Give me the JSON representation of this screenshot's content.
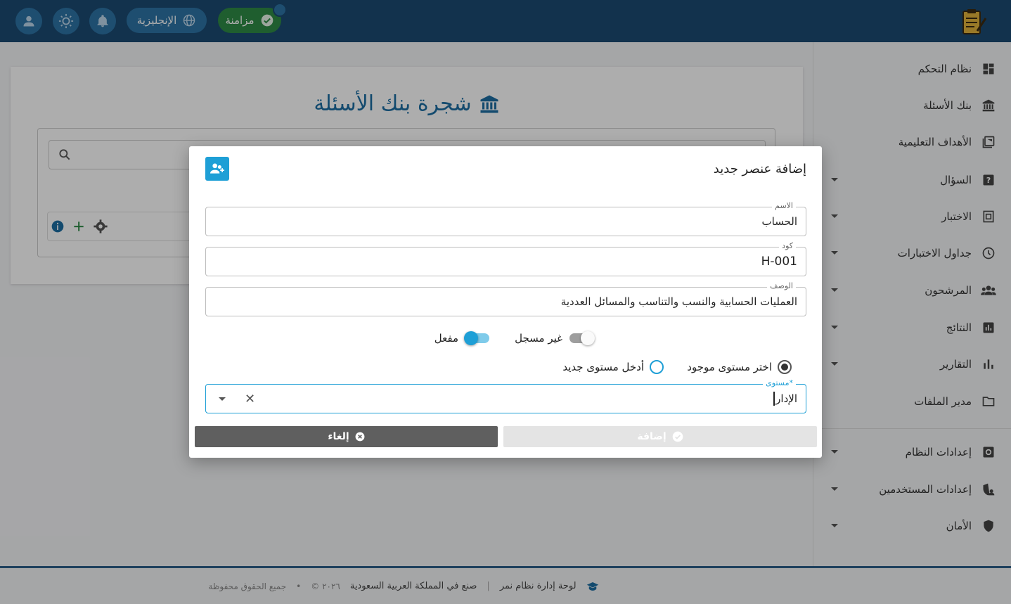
{
  "topbar": {
    "language_label": "الإنجليزية",
    "sync_label": "مزامنة"
  },
  "sidebar": {
    "items": [
      {
        "label": "نظام التحكم",
        "icon": "dashboard-icon",
        "expandable": false
      },
      {
        "label": "بنك الأسئلة",
        "icon": "bank-icon",
        "expandable": false
      },
      {
        "label": "الأهداف التعليمية",
        "icon": "objectives-icon",
        "expandable": false
      },
      {
        "label": "السؤال",
        "icon": "question-icon",
        "expandable": true
      },
      {
        "label": "الاختبار",
        "icon": "exam-icon",
        "expandable": true
      },
      {
        "label": "جداول الاختبارات",
        "icon": "clock-icon",
        "expandable": true
      },
      {
        "label": "المرشحون",
        "icon": "people-icon",
        "expandable": true
      },
      {
        "label": "النتائج",
        "icon": "results-icon",
        "expandable": true
      },
      {
        "label": "التقارير",
        "icon": "bar-chart-icon",
        "expandable": true
      },
      {
        "label": "مدير الملفات",
        "icon": "folder-icon",
        "expandable": false
      },
      {
        "label": "إعدادات النظام",
        "icon": "gear-icon",
        "expandable": true
      },
      {
        "label": "إعدادات المستخدمين",
        "icon": "user-shield-icon",
        "expandable": true
      },
      {
        "label": "الأمان",
        "icon": "shield-icon",
        "expandable": true
      }
    ]
  },
  "main": {
    "title": "شجرة بنك الأسئلة"
  },
  "dialog": {
    "title": "إضافة عنصر جديد",
    "name_label": "الاسم",
    "name_value": "الحساب",
    "code_label": "كود",
    "code_value": "H-001",
    "desc_label": "الوصف",
    "desc_value": "العمليات الحسابية والنسب والتناسب والمسائل العددية",
    "toggle_unregistered": "غير مسجل",
    "toggle_enabled": "مفعل",
    "radio_existing": "اختر مستوى موجود",
    "radio_new": "أدخل مستوى جديد",
    "level_label": "مستوى",
    "level_value": "الإدار",
    "add_button": "إضافة",
    "cancel_button": "إلغاء"
  },
  "footer": {
    "brand": "لوحة إدارة نظام نمر",
    "made_in": "صنع في المملكة العربية السعودية",
    "year": "© ٢٠٢٦",
    "rights": "جميع الحقوق محفوظة"
  },
  "colors": {
    "topbar": "#1b4a72",
    "accent": "#1e9fd6",
    "sync": "#2e8b46"
  }
}
